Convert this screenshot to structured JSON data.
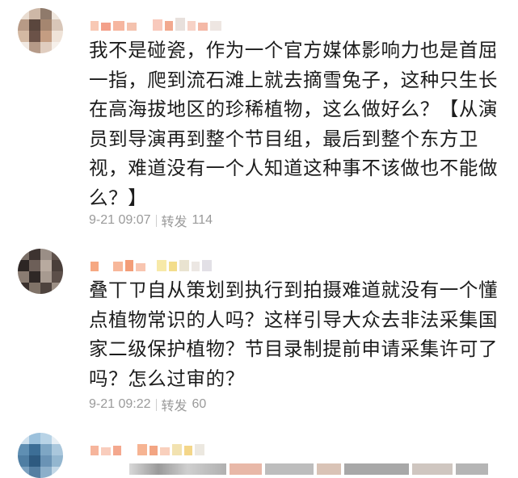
{
  "comments": [
    {
      "text": "我不是碰瓷，作为一个官方媒体影响力也是首屈一指，爬到流石滩上就去摘雪兔子，这种只生长在高海拔地区的珍稀植物，这么做好么？【从演员到导演再到整个节目组，最后到整个东方卫视，难道没有一个人知道这种事不该做也不能做么？】",
      "time": "9-21 09:07",
      "repost_label": "转发",
      "repost_count": "114"
    },
    {
      "text": "叠丅ㄗ自从策划到执行到拍摄难道就没有一个懂点植物常识的人吗？这样引导大众去非法采集国家二级保护植物？节目录制提前申请采集许可了吗？怎么过审的？",
      "time": "9-21 09:22",
      "repost_label": "转发",
      "repost_count": "60"
    }
  ],
  "colors": {
    "text": "#1c1c1c",
    "meta": "#9a9a9a"
  },
  "icons": [
    "avatar-mosaic",
    "username-mosaic"
  ]
}
